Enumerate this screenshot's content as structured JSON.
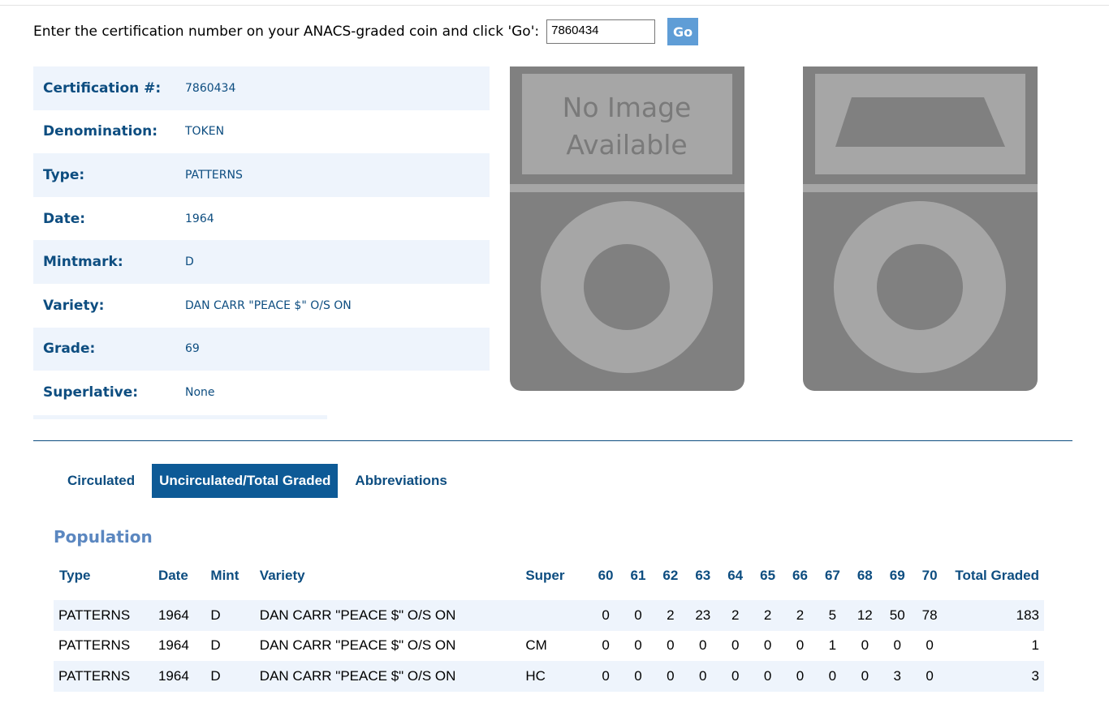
{
  "cert_lookup": {
    "label": "Enter the certification number on your ANACS-graded coin and click 'Go':",
    "value": "7860434",
    "go_label": "Go"
  },
  "details": [
    {
      "label": "Certification #:",
      "value": "7860434"
    },
    {
      "label": "Denomination:",
      "value": "TOKEN"
    },
    {
      "label": "Type:",
      "value": "PATTERNS"
    },
    {
      "label": "Date:",
      "value": "1964"
    },
    {
      "label": "Mintmark:",
      "value": "D"
    },
    {
      "label": "Variety:",
      "value": "DAN CARR \"PEACE $\" O/S ON"
    },
    {
      "label": "Grade:",
      "value": "69"
    },
    {
      "label": "Superlative:",
      "value": "None"
    }
  ],
  "images": {
    "placeholder_line1": "No Image",
    "placeholder_line2": "Available"
  },
  "tabs": [
    {
      "label": "Circulated",
      "active": false
    },
    {
      "label": "Uncirculated/Total Graded",
      "active": true
    },
    {
      "label": "Abbreviations",
      "active": false
    }
  ],
  "population": {
    "title": "Population",
    "headers": [
      "Type",
      "Date",
      "Mint",
      "Variety",
      "Super",
      "60",
      "61",
      "62",
      "63",
      "64",
      "65",
      "66",
      "67",
      "68",
      "69",
      "70",
      "Total Graded"
    ],
    "rows": [
      [
        "PATTERNS",
        "1964",
        "D",
        "DAN CARR \"PEACE $\" O/S ON",
        "",
        "0",
        "0",
        "2",
        "23",
        "2",
        "2",
        "2",
        "5",
        "12",
        "50",
        "78",
        "183"
      ],
      [
        "PATTERNS",
        "1964",
        "D",
        "DAN CARR \"PEACE $\" O/S ON",
        "CM",
        "0",
        "0",
        "0",
        "0",
        "0",
        "0",
        "0",
        "1",
        "0",
        "0",
        "0",
        "1"
      ],
      [
        "PATTERNS",
        "1964",
        "D",
        "DAN CARR \"PEACE $\" O/S ON",
        "HC",
        "0",
        "0",
        "0",
        "0",
        "0",
        "0",
        "0",
        "0",
        "0",
        "3",
        "0",
        "3"
      ]
    ]
  },
  "colors": {
    "brand_blue": "#0d4d80",
    "active_tab": "#0d5a96",
    "row_shade": "#eef4fc",
    "go_button": "#5f9dd6",
    "slab_gray": "#808080",
    "slab_light": "#a6a6a6"
  }
}
